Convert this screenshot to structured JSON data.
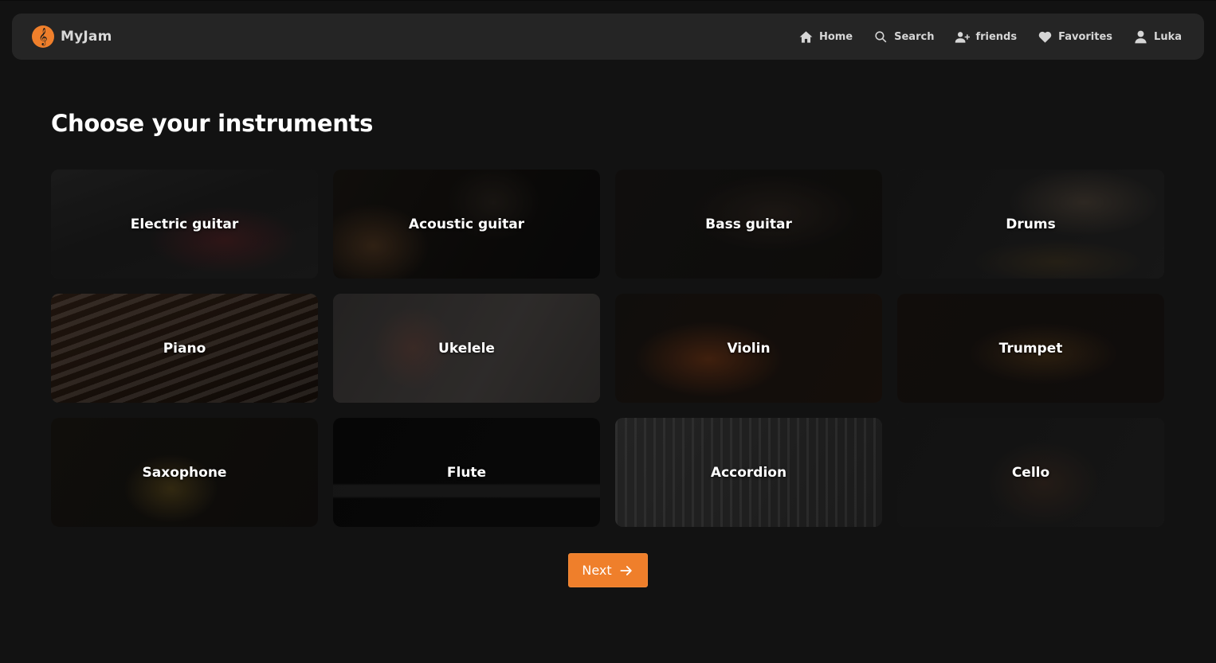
{
  "brand": {
    "name": "MyJam",
    "logo_icon": "treble-clef-icon"
  },
  "nav": {
    "items": [
      {
        "label": "Home",
        "icon": "home-icon"
      },
      {
        "label": "Search",
        "icon": "search-icon"
      },
      {
        "label": "friends",
        "icon": "add-user-icon"
      },
      {
        "label": "Favorites",
        "icon": "heart-icon"
      },
      {
        "label": "Luka",
        "icon": "user-icon"
      }
    ]
  },
  "page": {
    "title": "Choose your instruments"
  },
  "instruments": [
    {
      "label": "Electric guitar"
    },
    {
      "label": "Acoustic guitar"
    },
    {
      "label": "Bass guitar"
    },
    {
      "label": "Drums"
    },
    {
      "label": "Piano"
    },
    {
      "label": "Ukelele"
    },
    {
      "label": "Violin"
    },
    {
      "label": "Trumpet"
    },
    {
      "label": "Saxophone"
    },
    {
      "label": "Flute"
    },
    {
      "label": "Accordion"
    },
    {
      "label": "Cello"
    }
  ],
  "next_button": {
    "label": "Next",
    "icon": "arrow-right-icon"
  },
  "colors": {
    "accent": "#ef7f2b",
    "background": "#121212",
    "navbar": "#252525"
  }
}
